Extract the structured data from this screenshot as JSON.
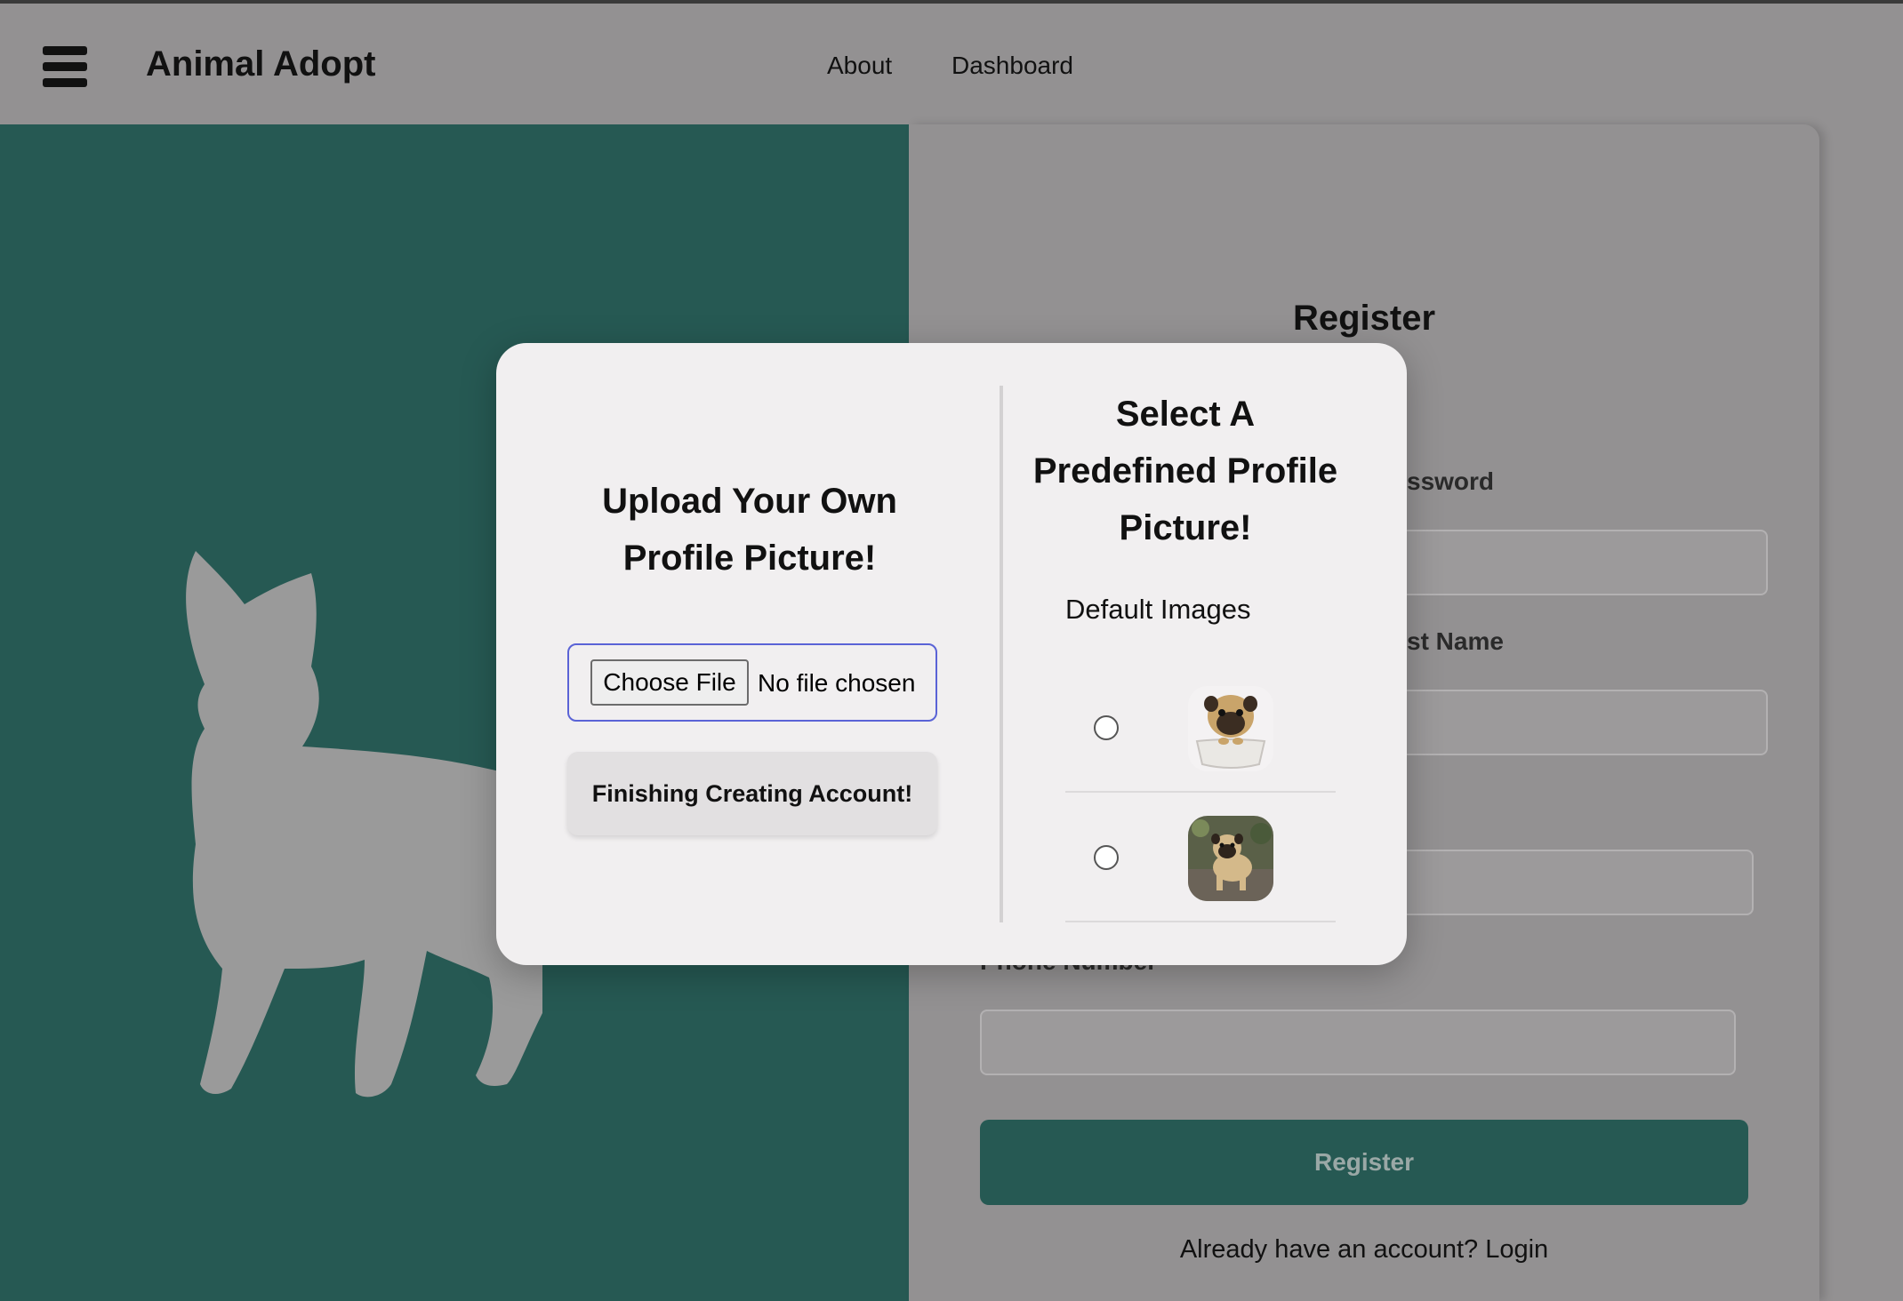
{
  "navbar": {
    "brand": "Animal Adopt",
    "links": [
      "About",
      "Dashboard"
    ]
  },
  "register_form": {
    "title": "Register",
    "fields": [
      {
        "label_visible": "ssword"
      },
      {
        "label_visible": "st Name"
      },
      {
        "label_visible": ""
      },
      {
        "label_visible": "Phone Number"
      }
    ],
    "submit_label": "Register",
    "login_prompt": "Already have an account? Login"
  },
  "modal": {
    "upload": {
      "title": "Upload Your Own Profile Picture!",
      "choose_file_label": "Choose File",
      "file_status": "No file chosen",
      "finish_label": "Finishing Creating Account!"
    },
    "predefined": {
      "title": "Select A Predefined Profile Picture!",
      "default_label": "Default Images",
      "images": [
        {
          "icon": "pug-in-teacup-image",
          "selected": false
        },
        {
          "icon": "pug-standing-image",
          "selected": false
        }
      ]
    }
  },
  "colors": {
    "accent_green": "#265953",
    "overlay_gray": "#939192",
    "modal_bg": "#f1eff0",
    "file_input_border": "#5a63d6"
  }
}
